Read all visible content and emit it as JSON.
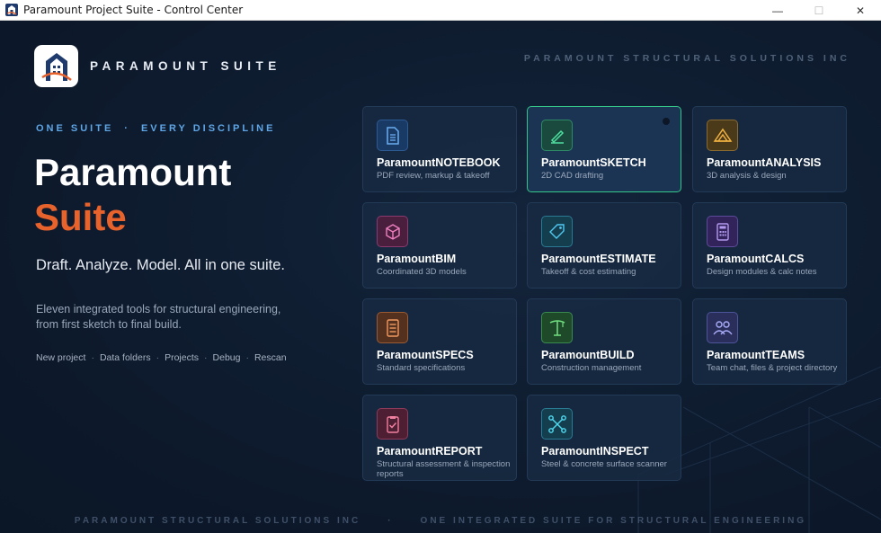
{
  "window": {
    "title": "Paramount Project Suite - Control Center",
    "minimize": "—",
    "maximize": "☐",
    "close": "✕"
  },
  "brand": {
    "name": "PARAMOUNT SUITE",
    "company": "PARAMOUNT STRUCTURAL SOLUTIONS INC",
    "logo_icon": "paramount-building-logo"
  },
  "hero": {
    "tagline_left": "ONE SUITE",
    "tagline_sep": "·",
    "tagline_right": "EVERY DISCIPLINE",
    "title_line1": "Paramount",
    "title_line2": "Suite",
    "subhead": "Draft. Analyze. Model. All in one suite.",
    "description": "Eleven integrated tools for structural engineering, from first sketch to final build.",
    "accent_color": "#e8622c"
  },
  "links": [
    "New project",
    "Data folders",
    "Projects",
    "Debug",
    "Rescan"
  ],
  "link_sep": "·",
  "apps": [
    {
      "name": "ParamountNOTEBOOK",
      "desc": "PDF review, markup & takeoff",
      "icon": "document-icon",
      "color": "#4a8fe0"
    },
    {
      "name": "ParamountSKETCH",
      "desc": "2D CAD drafting",
      "icon": "pen-icon",
      "color": "#35c68a"
    },
    {
      "name": "ParamountANALYSIS",
      "desc": "3D analysis & design",
      "icon": "truss-icon",
      "color": "#e0a030"
    },
    {
      "name": "ParamountBIM",
      "desc": "Coordinated 3D models",
      "icon": "cube-icon",
      "color": "#e06aa8"
    },
    {
      "name": "ParamountESTIMATE",
      "desc": "Takeoff & cost estimating",
      "icon": "tag-icon",
      "color": "#35b6d8"
    },
    {
      "name": "ParamountCALCS",
      "desc": "Design modules & calc notes",
      "icon": "calculator-icon",
      "color": "#9b7ae0"
    },
    {
      "name": "ParamountSPECS",
      "desc": "Standard specifications",
      "icon": "spec-list-icon",
      "color": "#e8824a"
    },
    {
      "name": "ParamountBUILD",
      "desc": "Construction management",
      "icon": "crane-icon",
      "color": "#5cc870"
    },
    {
      "name": "ParamountTEAMS",
      "desc": "Team chat, files & project directory",
      "icon": "people-icon",
      "color": "#8a8ee8"
    },
    {
      "name": "ParamountREPORT",
      "desc": "Structural assessment & inspection reports",
      "icon": "clipboard-check-icon",
      "color": "#e06a8a"
    },
    {
      "name": "ParamountINSPECT",
      "desc": "Steel & concrete surface scanner",
      "icon": "scanner-icon",
      "color": "#35c6d8"
    }
  ],
  "active_app": "ParamountSKETCH",
  "footer": {
    "left": "PARAMOUNT STRUCTURAL SOLUTIONS INC",
    "sep": "·",
    "right": "ONE INTEGRATED SUITE FOR STRUCTURAL ENGINEERING"
  }
}
